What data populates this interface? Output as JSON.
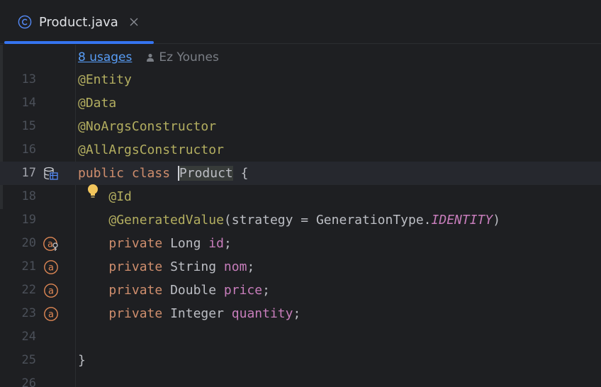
{
  "tab": {
    "title": "Product.java",
    "icon": "class-icon",
    "close_icon": "close-icon",
    "accent_color": "#3574f0"
  },
  "inlay_hint": {
    "usages": "8 usages",
    "author": "Ez Younes"
  },
  "colors": {
    "background": "#1e1f22",
    "annotation": "#b3ae60",
    "keyword": "#cf8e6d",
    "text": "#bcbec4",
    "field": "#c77dbb",
    "line_number": "#4b5059"
  },
  "code": {
    "lines": [
      {
        "number": "13",
        "tokens": [
          {
            "text": "@Entity",
            "kind": "annotation"
          }
        ]
      },
      {
        "number": "14",
        "tokens": [
          {
            "text": "@Data",
            "kind": "annotation"
          }
        ]
      },
      {
        "number": "15",
        "tokens": [
          {
            "text": "@NoArgsConstructor",
            "kind": "annotation"
          }
        ]
      },
      {
        "number": "16",
        "tokens": [
          {
            "text": "@AllArgsConstructor",
            "kind": "annotation"
          }
        ]
      },
      {
        "number": "17",
        "current": true,
        "gutter_icon": "database-entity-icon",
        "tokens": [
          {
            "text": "public class ",
            "kind": "keyword"
          },
          {
            "text": "Product",
            "kind": "ident-highlight"
          },
          {
            "text": " {",
            "kind": "plain"
          }
        ]
      },
      {
        "number": "18",
        "tokens": [
          {
            "text": "    ",
            "kind": "plain"
          },
          {
            "text": "@Id",
            "kind": "annotation"
          }
        ]
      },
      {
        "number": "19",
        "tokens": [
          {
            "text": "    ",
            "kind": "plain"
          },
          {
            "text": "@GeneratedValue",
            "kind": "annotation"
          },
          {
            "text": "(strategy = GenerationType.",
            "kind": "plain"
          },
          {
            "text": "IDENTITY",
            "kind": "constant"
          },
          {
            "text": ")",
            "kind": "plain"
          }
        ]
      },
      {
        "number": "20",
        "gutter_icon": "id-attribute-icon",
        "tokens": [
          {
            "text": "    ",
            "kind": "plain"
          },
          {
            "text": "private ",
            "kind": "keyword"
          },
          {
            "text": "Long ",
            "kind": "plain"
          },
          {
            "text": "id",
            "kind": "field"
          },
          {
            "text": ";",
            "kind": "plain"
          }
        ]
      },
      {
        "number": "21",
        "gutter_icon": "attribute-icon",
        "tokens": [
          {
            "text": "    ",
            "kind": "plain"
          },
          {
            "text": "private ",
            "kind": "keyword"
          },
          {
            "text": "String ",
            "kind": "plain"
          },
          {
            "text": "nom",
            "kind": "field"
          },
          {
            "text": ";",
            "kind": "plain"
          }
        ]
      },
      {
        "number": "22",
        "gutter_icon": "attribute-icon",
        "tokens": [
          {
            "text": "    ",
            "kind": "plain"
          },
          {
            "text": "private ",
            "kind": "keyword"
          },
          {
            "text": "Double ",
            "kind": "plain"
          },
          {
            "text": "price",
            "kind": "field"
          },
          {
            "text": ";",
            "kind": "plain"
          }
        ]
      },
      {
        "number": "23",
        "gutter_icon": "attribute-icon",
        "tokens": [
          {
            "text": "    ",
            "kind": "plain"
          },
          {
            "text": "private ",
            "kind": "keyword"
          },
          {
            "text": "Integer ",
            "kind": "plain"
          },
          {
            "text": "quantity",
            "kind": "field"
          },
          {
            "text": ";",
            "kind": "plain"
          }
        ]
      },
      {
        "number": "24",
        "tokens": []
      },
      {
        "number": "25",
        "tokens": [
          {
            "text": "}",
            "kind": "plain"
          }
        ]
      },
      {
        "number": "26",
        "tokens": []
      }
    ]
  },
  "intention_bulb": "lightbulb-icon"
}
